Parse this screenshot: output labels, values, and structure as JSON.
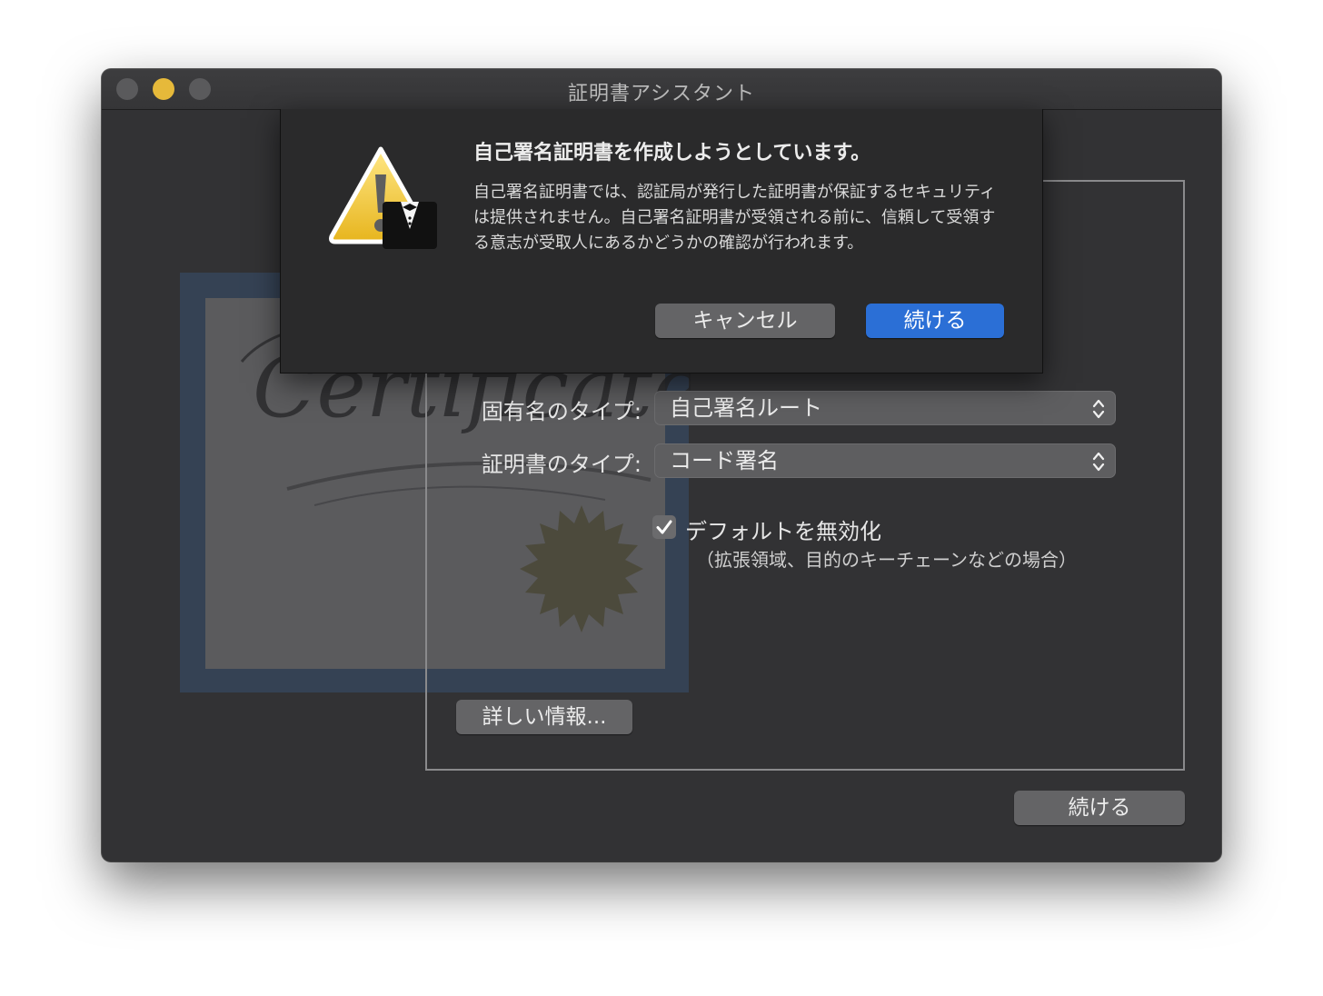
{
  "window": {
    "title": "証明書アシスタント"
  },
  "form": {
    "identity_type_label": "固有名のタイプ:",
    "identity_type_value": "自己署名ルート",
    "certificate_type_label": "証明書のタイプ:",
    "certificate_type_value": "コード署名",
    "override_defaults_label": "デフォルトを無効化",
    "override_defaults_checked": true,
    "override_defaults_sub": "（拡張領域、目的のキーチェーンなどの場合）",
    "learn_more_label": "詳しい情報...",
    "continue_label": "続ける"
  },
  "artwork": {
    "certificate_script": "Certificate"
  },
  "alert": {
    "title": "自己署名証明書を作成しようとしています。",
    "message": "自己署名証明書では、認証局が発行した証明書が保証するセキュリティは提供されません。自己署名証明書が受領される前に、信頼して受領する意志が受取人にあるかどうかの確認が行われます。",
    "cancel_label": "キャンセル",
    "continue_label": "続ける"
  },
  "colors": {
    "window_bg": "#323234",
    "sheet_bg": "#2a2a2b",
    "accent": "#2b6fd6",
    "traffic_minimize": "#e6b93a",
    "traffic_inactive": "#5a5a5c"
  },
  "icons": [
    "warning-icon",
    "tuxedo-badge-icon",
    "chevrons-updown-icon",
    "checkmark-icon",
    "seal-icon"
  ]
}
